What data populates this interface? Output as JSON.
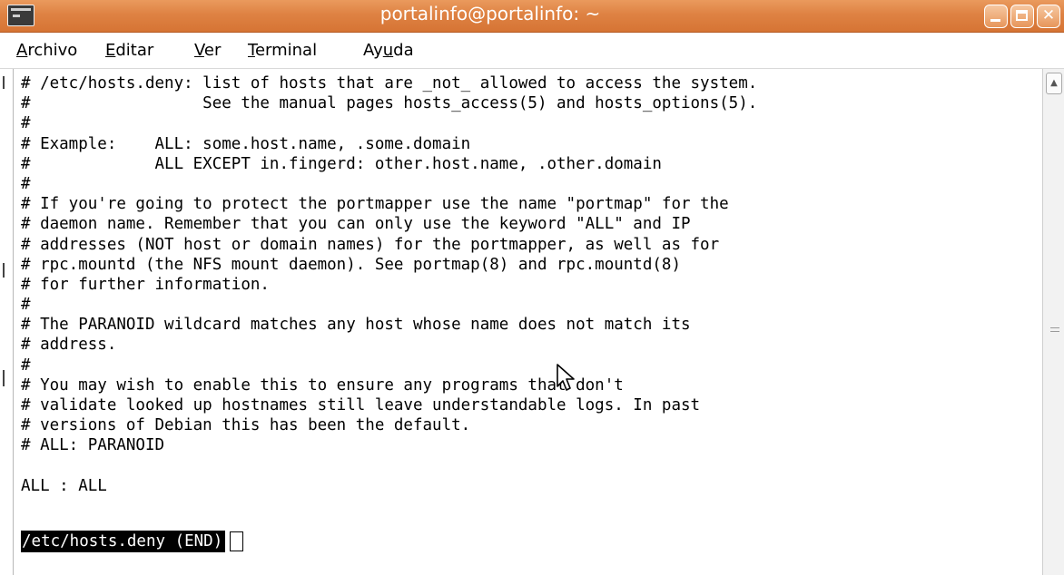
{
  "window": {
    "title": "portalinfo@portalinfo: ~"
  },
  "menubar": {
    "items": [
      {
        "label": "Archivo",
        "mnemonic": "A",
        "rest": "rchivo"
      },
      {
        "label": "Editar",
        "mnemonic": "E",
        "rest": "ditar"
      },
      {
        "label": "Ver",
        "mnemonic": "V",
        "rest": "er"
      },
      {
        "label": "Terminal",
        "mnemonic": "T",
        "rest": "erminal"
      },
      {
        "label": "Ayuda",
        "pre": "Ay",
        "mnemonic": "u",
        "rest": "da"
      }
    ]
  },
  "terminal": {
    "lines": [
      "# /etc/hosts.deny: list of hosts that are _not_ allowed to access the system.",
      "#                  See the manual pages hosts_access(5) and hosts_options(5).",
      "#",
      "# Example:    ALL: some.host.name, .some.domain",
      "#             ALL EXCEPT in.fingerd: other.host.name, .other.domain",
      "#",
      "# If you're going to protect the portmapper use the name \"portmap\" for the",
      "# daemon name. Remember that you can only use the keyword \"ALL\" and IP",
      "# addresses (NOT host or domain names) for the portmapper, as well as for",
      "# rpc.mountd (the NFS mount daemon). See portmap(8) and rpc.mountd(8)",
      "# for further information.",
      "#",
      "# The PARANOID wildcard matches any host whose name does not match its",
      "# address.",
      "#",
      "# You may wish to enable this to ensure any programs that don't",
      "# validate looked up hostnames still leave understandable logs. In past",
      "# versions of Debian this has been the default.",
      "# ALL: PARANOID",
      "",
      "ALL : ALL"
    ],
    "status_line": "/etc/hosts.deny (END)"
  },
  "icons": {
    "app": "terminal-icon",
    "minimize": "minimize-icon",
    "maximize": "maximize-icon",
    "close": "close-icon",
    "pointer": "mouse-pointer-icon",
    "scroll_up": "scroll-up-arrow-icon"
  },
  "colors": {
    "titlebar": "#de8243",
    "terminal_bg": "#ffffff",
    "terminal_fg": "#000000",
    "status_bg": "#000000",
    "status_fg": "#ffffff"
  }
}
